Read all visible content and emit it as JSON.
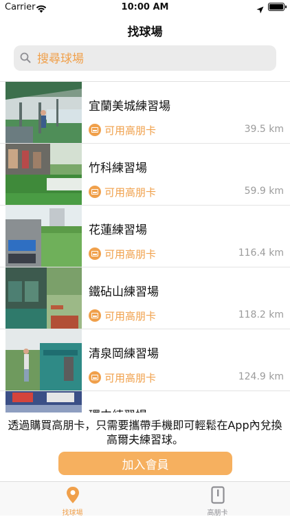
{
  "status_bar": {
    "carrier": "Carrier",
    "time": "10:00 AM"
  },
  "nav": {
    "title": "找球場"
  },
  "search": {
    "placeholder": "搜尋球場"
  },
  "ranges": [
    {
      "name": "宜蘭美城練習場",
      "card": "可用高朋卡",
      "distance": "39.5 km"
    },
    {
      "name": "竹科練習場",
      "card": "可用高朋卡",
      "distance": "59.9 km"
    },
    {
      "name": "花蓮練習場",
      "card": "可用高朋卡",
      "distance": "116.4 km"
    },
    {
      "name": "鐵砧山練習場",
      "card": "可用高朋卡",
      "distance": "118.2 km"
    },
    {
      "name": "清泉岡練習場",
      "card": "可用高朋卡",
      "distance": "124.9 km"
    },
    {
      "name": "環中練習場",
      "card": "",
      "distance": ""
    }
  ],
  "promo": {
    "text": "透過購買高朋卡，只需要攜帶手機即可輕鬆在App內兌換高爾夫練習球。",
    "button_label": "加入會員"
  },
  "tabs": [
    {
      "label": "找球場",
      "icon": "location-pin-icon",
      "active": true
    },
    {
      "label": "高朋卡",
      "icon": "card-icon",
      "active": false
    }
  ],
  "colors": {
    "accent": "#f0a04b",
    "button": "#f6b05f",
    "inactive": "#8e8e93"
  }
}
